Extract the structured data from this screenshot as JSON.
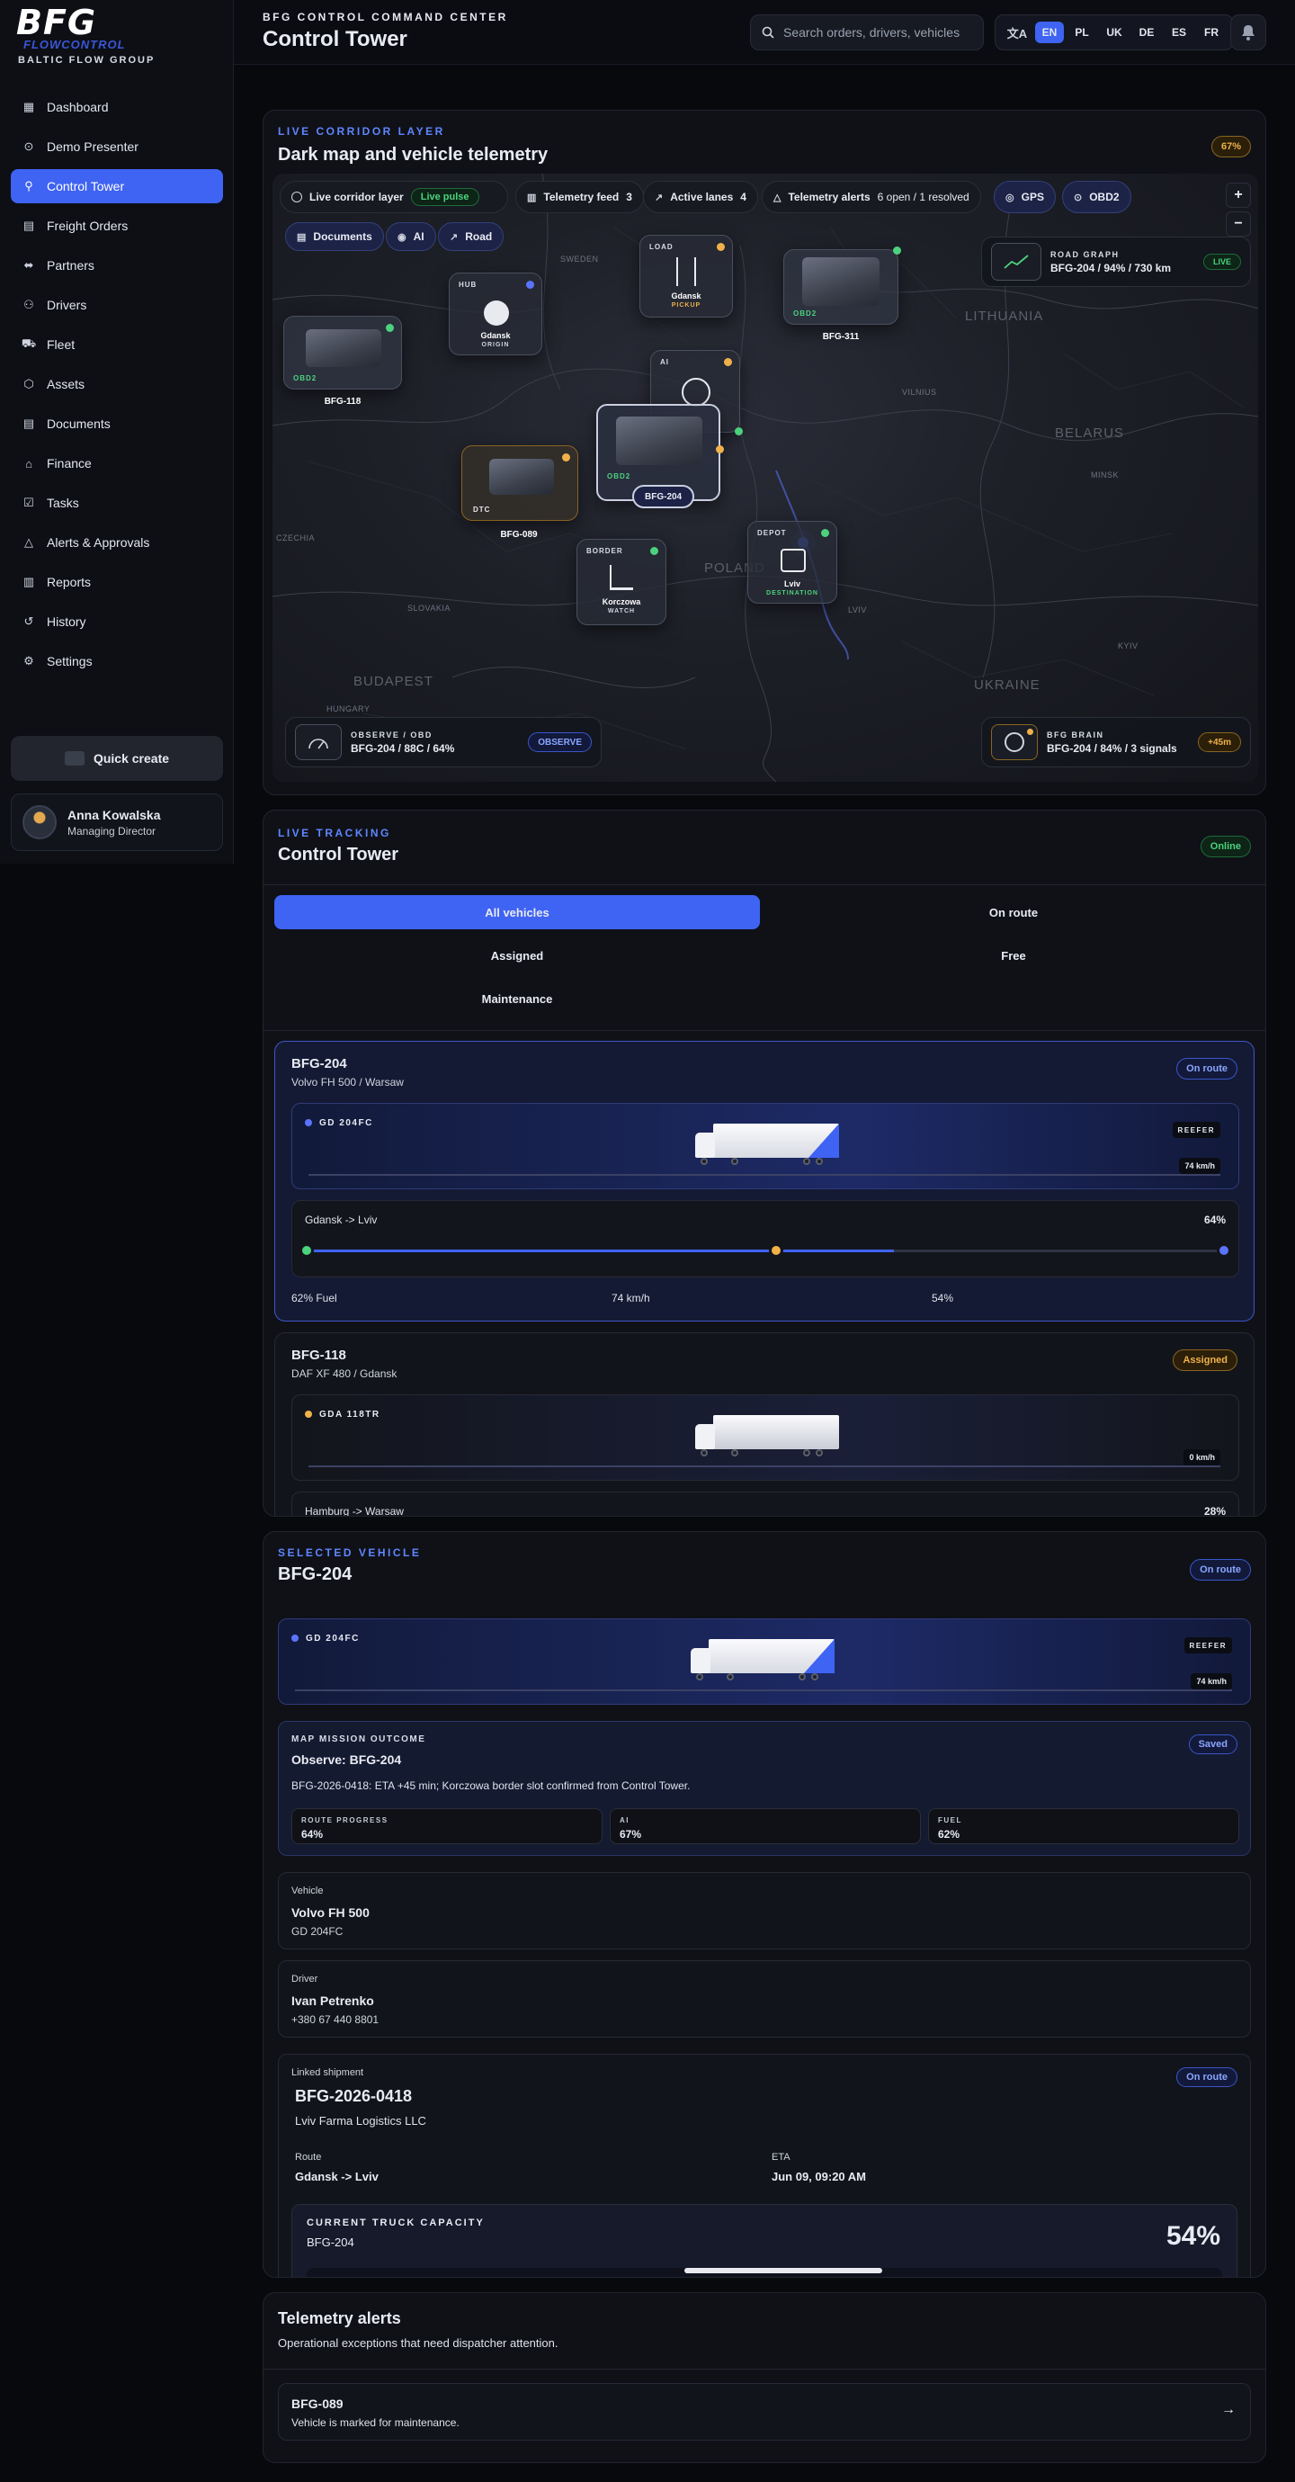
{
  "brand": {
    "logo": "BFG",
    "sub": "FLOWCONTROL",
    "company": "BALTIC FLOW GROUP"
  },
  "sidebar": {
    "items": [
      {
        "label": "Dashboard",
        "icon": "grid-icon"
      },
      {
        "label": "Demo Presenter",
        "icon": "play-circle-icon"
      },
      {
        "label": "Control Tower",
        "icon": "user-pin-icon",
        "active": true
      },
      {
        "label": "Freight Orders",
        "icon": "clipboard-icon"
      },
      {
        "label": "Partners",
        "icon": "handshake-icon"
      },
      {
        "label": "Drivers",
        "icon": "user-icon"
      },
      {
        "label": "Fleet",
        "icon": "truck-icon"
      },
      {
        "label": "Assets",
        "icon": "cube-icon"
      },
      {
        "label": "Documents",
        "icon": "document-icon"
      },
      {
        "label": "Finance",
        "icon": "bank-icon"
      },
      {
        "label": "Tasks",
        "icon": "checklist-icon"
      },
      {
        "label": "Alerts & Approvals",
        "icon": "warning-icon"
      },
      {
        "label": "Reports",
        "icon": "report-icon"
      },
      {
        "label": "History",
        "icon": "history-icon"
      },
      {
        "label": "Settings",
        "icon": "gear-icon"
      }
    ],
    "quick_create": "Quick create",
    "user": {
      "name": "Anna Kowalska",
      "role": "Managing Director"
    }
  },
  "header": {
    "eyebrow": "BFG CONTROL COMMAND CENTER",
    "title": "Control Tower",
    "search_placeholder": "Search orders, drivers, vehicles",
    "languages": [
      "EN",
      "PL",
      "UK",
      "DE",
      "ES",
      "FR"
    ],
    "active_language": "EN"
  },
  "map_card": {
    "eyebrow": "LIVE CORRIDOR LAYER",
    "title": "Dark map and vehicle telemetry",
    "badge": "67%",
    "toolbar": {
      "live_layer": "Live corridor layer",
      "live_pulse": "Live pulse",
      "telemetry_feed": "Telemetry feed",
      "telemetry_feed_count": "3",
      "active_lanes": "Active lanes",
      "active_lanes_count": "4",
      "telemetry_alerts": "Telemetry alerts",
      "telemetry_alerts_count": "6 open / 1 resolved",
      "gps": "GPS",
      "obd2": "OBD2",
      "documents": "Documents",
      "ai": "AI",
      "road": "Road"
    },
    "zoom_in": "+",
    "zoom_out": "−",
    "road_graph": {
      "label": "ROAD GRAPH",
      "value": "BFG-204 / 94% / 730 km",
      "badge": "LIVE"
    },
    "nodes": {
      "hub": {
        "tag": "HUB",
        "name": "Gdansk",
        "sub": "ORIGIN"
      },
      "load": {
        "tag": "LOAD",
        "name": "Gdansk",
        "sub": "PICKUP"
      },
      "ai": {
        "tag": "AI"
      },
      "border": {
        "tag": "BORDER",
        "name": "Korczowa",
        "sub": "WATCH"
      },
      "depot": {
        "tag": "DEPOT",
        "name": "Lviv",
        "sub": "DESTINATION"
      }
    },
    "vehicles": {
      "v118": {
        "label": "BFG-118",
        "tag": "OBD2"
      },
      "v311": {
        "label": "BFG-311",
        "tag": "OBD2"
      },
      "v204": {
        "label": "BFG-204",
        "tag": "OBD2"
      },
      "v089": {
        "label": "BFG-089",
        "tag": "DTC"
      }
    },
    "map_labels": {
      "lithuania": "LITHUANIA",
      "belarus": "BELARUS",
      "poland": "POLAND",
      "ukraine": "UKRAINE",
      "slovakia": "SLOVAKIA",
      "hungary": "HUNGARY",
      "budapest": "BUDAPEST",
      "sweden": "SWEDEN",
      "vilnius": "VILNIUS",
      "minsk": "MINSK",
      "kyiv": "KYIV",
      "czechia": "CZECHIA",
      "lviv": "LVIV"
    },
    "observe": {
      "label": "OBSERVE / OBD",
      "value": "BFG-204 / 88C / 64%",
      "badge": "OBSERVE"
    },
    "brain": {
      "label": "BFG BRAIN",
      "value": "BFG-204 / 84% / 3 signals",
      "badge": "+45m"
    }
  },
  "tracking": {
    "eyebrow": "LIVE TRACKING",
    "title": "Control Tower",
    "status": "Online",
    "filters": [
      "All vehicles",
      "On route",
      "Assigned",
      "Free",
      "Maintenance"
    ],
    "active_filter": "All vehicles",
    "vehicles": [
      {
        "id": "BFG-204",
        "model": "Volvo FH 500 / Warsaw",
        "status": "On route",
        "plate": "GD 204FC",
        "type": "REEFER",
        "speed": "74 km/h",
        "route": "Gdansk -> Lviv",
        "progress": "64%",
        "fuel": "62% Fuel",
        "speed2": "74 km/h",
        "capacity": "54%",
        "progress_value": 0.64
      },
      {
        "id": "BFG-118",
        "model": "DAF XF 480 / Gdansk",
        "status": "Assigned",
        "plate": "GDA 118TR",
        "speed": "0 km/h",
        "route": "Hamburg -> Warsaw",
        "progress": "28%"
      }
    ]
  },
  "selected": {
    "eyebrow": "SELECTED VEHICLE",
    "title": "BFG-204",
    "status": "On route",
    "plate": "GD 204FC",
    "type": "REEFER",
    "speed": "74 km/h",
    "mission": {
      "label": "MAP MISSION OUTCOME",
      "title": "Observe: BFG-204",
      "badge": "Saved",
      "text": "BFG-2026-0418: ETA +45 min; Korczowa border slot confirmed from Control Tower.",
      "stats": [
        {
          "label": "ROUTE PROGRESS",
          "value": "64%"
        },
        {
          "label": "AI",
          "value": "67%"
        },
        {
          "label": "FUEL",
          "value": "62%"
        }
      ]
    },
    "vehicle": {
      "label": "Vehicle",
      "name": "Volvo FH 500",
      "plate": "GD 204FC"
    },
    "driver": {
      "label": "Driver",
      "name": "Ivan Petrenko",
      "phone": "+380 67 440 8801"
    },
    "shipment": {
      "label": "Linked shipment",
      "id": "BFG-2026-0418",
      "company": "Lviv Farma Logistics LLC",
      "status": "On route",
      "route_label": "Route",
      "route": "Gdansk -> Lviv",
      "eta_label": "ETA",
      "eta": "Jun 09, 09:20 AM",
      "capacity_label": "CURRENT TRUCK CAPACITY",
      "capacity_vehicle": "BFG-204",
      "capacity_value": "54%"
    }
  },
  "alerts": {
    "title": "Telemetry alerts",
    "subtitle": "Operational exceptions that need dispatcher attention.",
    "items": [
      {
        "id": "BFG-089",
        "text": "Vehicle is marked for maintenance."
      }
    ]
  },
  "colors": {
    "accent": "#3f63f2",
    "green": "#4cd27e",
    "amber": "#f0b14a",
    "bg": "#08090d"
  }
}
